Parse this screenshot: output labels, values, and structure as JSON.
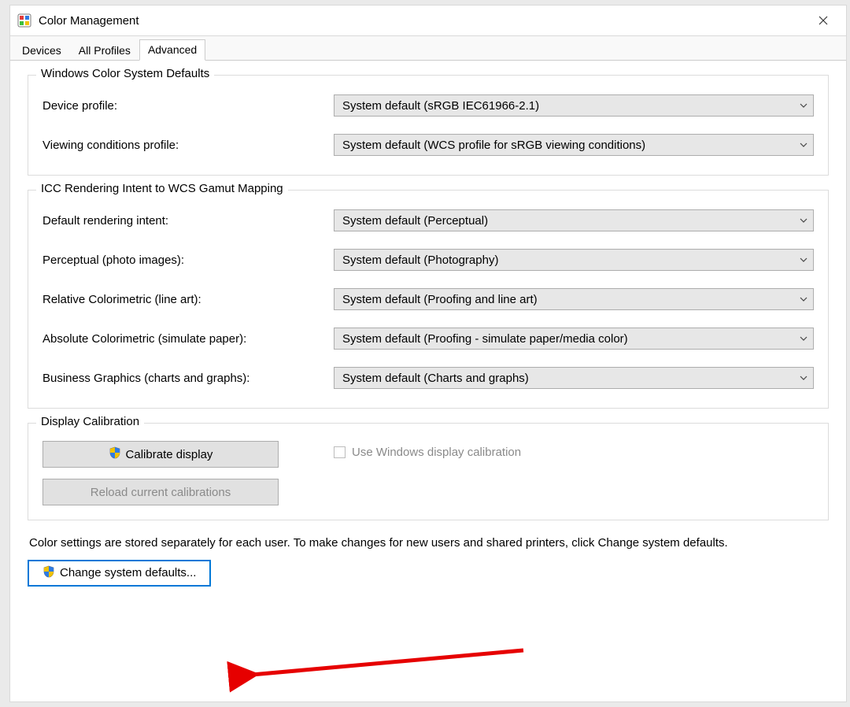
{
  "window": {
    "title": "Color Management"
  },
  "tabs": [
    {
      "label": "Devices",
      "active": false
    },
    {
      "label": "All Profiles",
      "active": false
    },
    {
      "label": "Advanced",
      "active": true
    }
  ],
  "group_wcs_defaults": {
    "legend": "Windows Color System Defaults",
    "device_profile_label": "Device profile:",
    "device_profile_value": "System default (sRGB IEC61966-2.1)",
    "viewing_conditions_label": "Viewing conditions profile:",
    "viewing_conditions_value": "System default (WCS profile for sRGB viewing conditions)"
  },
  "group_icc_mapping": {
    "legend": "ICC Rendering Intent to WCS Gamut Mapping",
    "default_intent_label": "Default rendering intent:",
    "default_intent_value": "System default (Perceptual)",
    "perceptual_label": "Perceptual (photo images):",
    "perceptual_value": "System default (Photography)",
    "relative_label": "Relative Colorimetric (line art):",
    "relative_value": "System default (Proofing and line art)",
    "absolute_label": "Absolute Colorimetric (simulate paper):",
    "absolute_value": "System default (Proofing - simulate paper/media color)",
    "business_label": "Business Graphics (charts and graphs):",
    "business_value": "System default (Charts and graphs)"
  },
  "group_display_calibration": {
    "legend": "Display Calibration",
    "calibrate_button": "Calibrate display",
    "reload_button": "Reload current calibrations",
    "use_windows_calibration_label": "Use Windows display calibration"
  },
  "footer": {
    "note": "Color settings are stored separately for each user. To make changes for new users and shared printers, click Change system defaults.",
    "change_defaults_button": "Change system defaults..."
  }
}
